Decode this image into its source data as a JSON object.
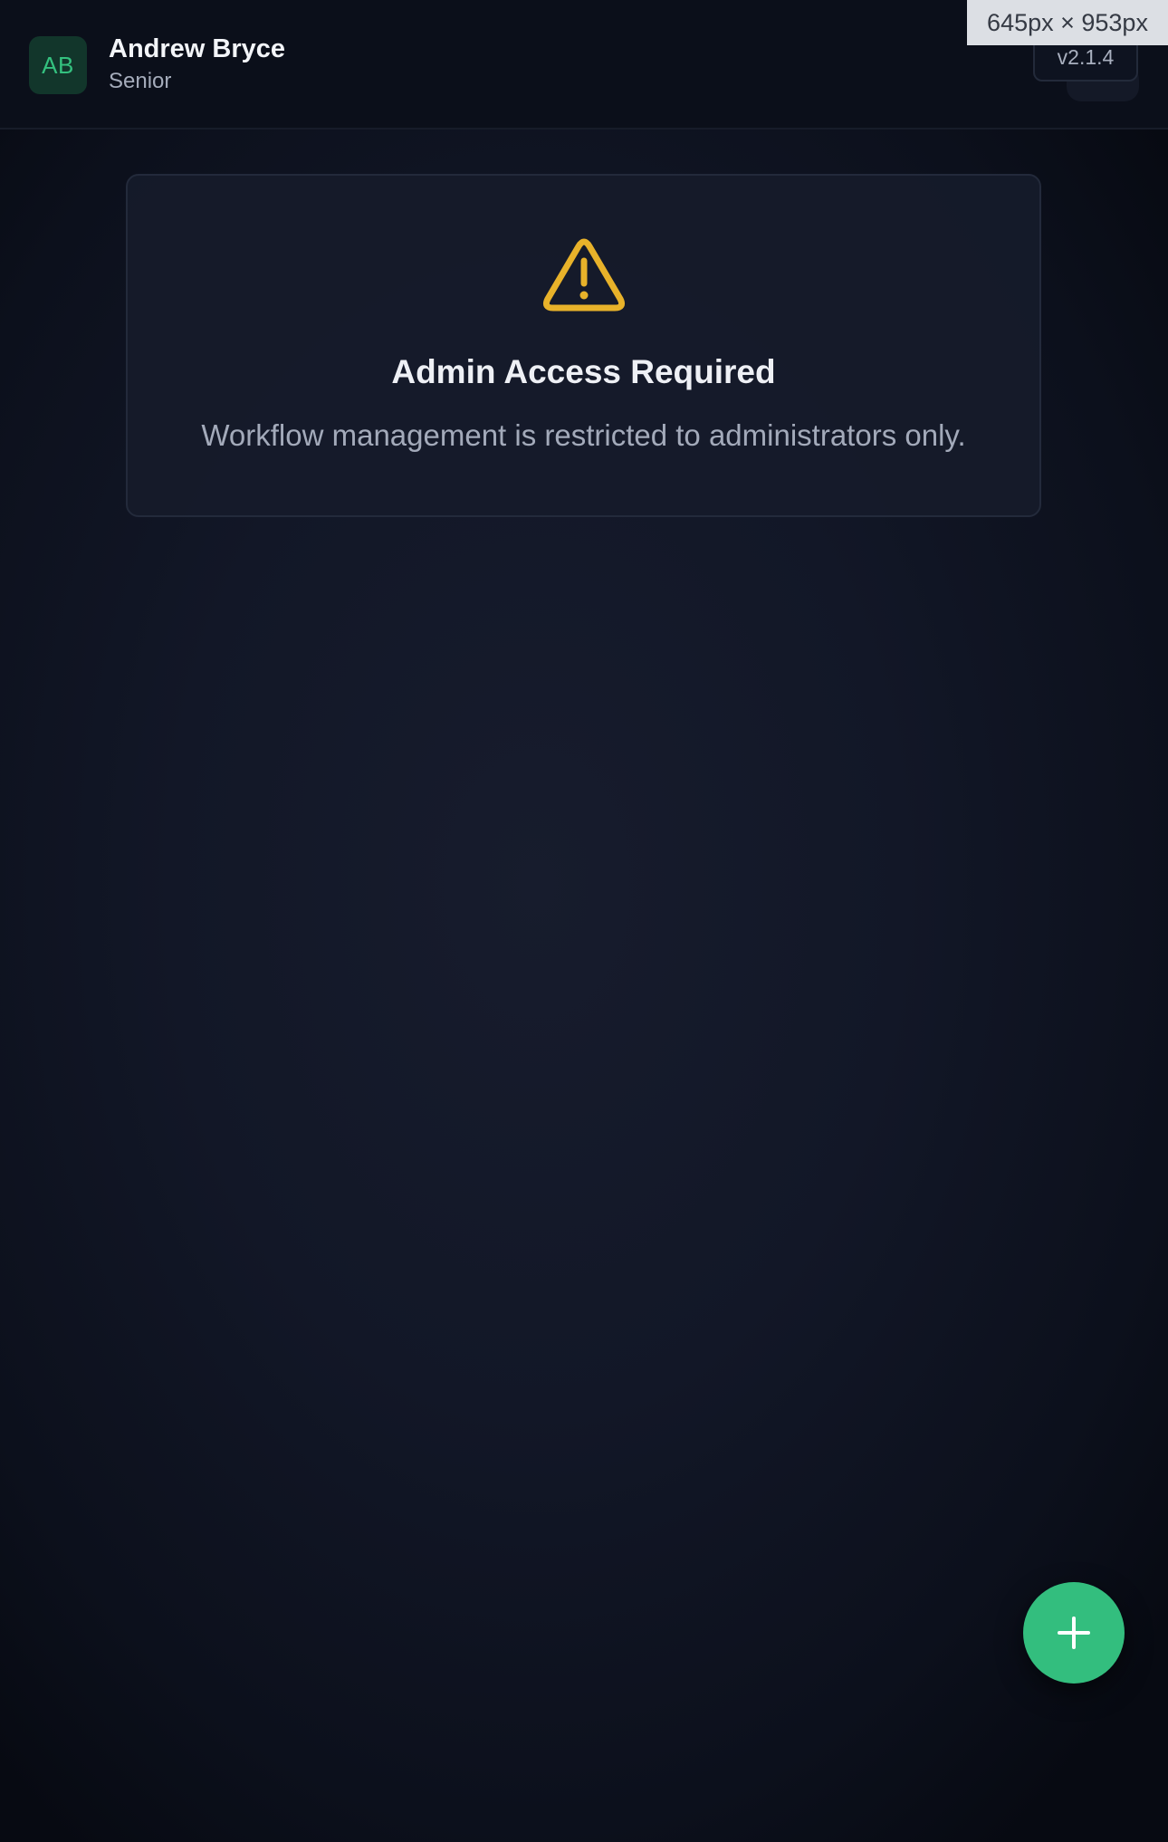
{
  "header": {
    "user": {
      "initials": "AB",
      "name": "Andrew Bryce",
      "role": "Senior"
    },
    "version": "v2.1.4"
  },
  "viewport_indicator": "645px × 953px",
  "notice": {
    "icon": "warning-triangle-icon",
    "title": "Admin Access Required",
    "message": "Workflow management is restricted to administrators only."
  },
  "fab": {
    "icon": "plus-icon"
  },
  "colors": {
    "accent": "#33be7e",
    "warning": "#e8b22a",
    "background": "#111626"
  }
}
